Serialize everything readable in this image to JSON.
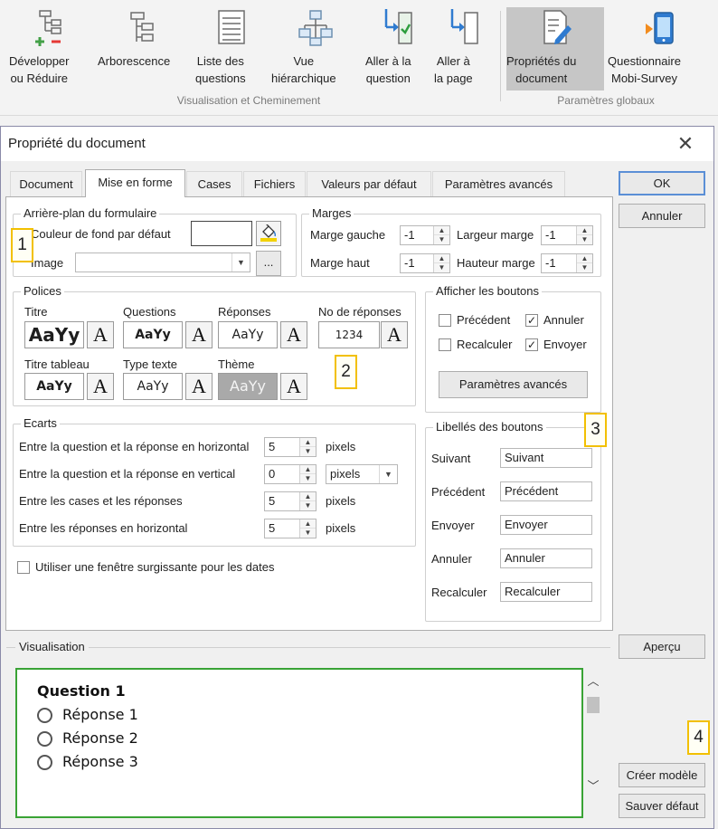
{
  "ribbon": {
    "buttons": [
      {
        "label": "Développer\nou Réduire",
        "icon": "expand-collapse-icon"
      },
      {
        "label": "Arborescence",
        "icon": "tree-icon"
      },
      {
        "label": "Liste des\nquestions",
        "icon": "list-icon"
      },
      {
        "label": "Vue\nhiérarchique",
        "icon": "hierarchy-icon"
      },
      {
        "label": "Aller à la\nquestion",
        "icon": "goto-question-icon"
      },
      {
        "label": "Aller à\nla page",
        "icon": "goto-page-icon"
      },
      {
        "label": "Propriétés du\ndocument",
        "icon": "document-properties-icon"
      },
      {
        "label": "Questionnaire\nMobi-Survey",
        "icon": "mobile-survey-icon"
      }
    ],
    "group1": "Visualisation et Cheminement",
    "group2": "Paramètres globaux"
  },
  "dialog": {
    "title": "Propriété du document",
    "close": "✕",
    "tabs": [
      "Document",
      "Mise en forme",
      "Cases",
      "Fichiers",
      "Valeurs par défaut",
      "Paramètres avancés"
    ],
    "active_tab": "Mise en forme",
    "buttons": {
      "ok": "OK",
      "cancel": "Annuler",
      "preview": "Aperçu",
      "create_template": "Créer modèle",
      "save_default": "Sauver défaut"
    }
  },
  "background": {
    "title": "Arrière-plan du formulaire",
    "bg_color_label": "Couleur de fond par défaut",
    "image_label": "Image",
    "image_value": "",
    "browse": "..."
  },
  "margins": {
    "title": "Marges",
    "left_label": "Marge gauche",
    "left_value": "-1",
    "top_label": "Marge haut",
    "top_value": "-1",
    "width_label": "Largeur marge",
    "width_value": "-1",
    "height_label": "Hauteur marge",
    "height_value": "-1"
  },
  "fonts": {
    "title": "Polices",
    "items": [
      {
        "label": "Titre",
        "sample": "AaYy"
      },
      {
        "label": "Questions",
        "sample": "AaYy"
      },
      {
        "label": "Réponses",
        "sample": "AaYy"
      },
      {
        "label": "No de réponses",
        "sample": "1234"
      },
      {
        "label": "Titre tableau",
        "sample": "AaYy"
      },
      {
        "label": "Type texte",
        "sample": "AaYy"
      },
      {
        "label": "Thème",
        "sample": "AaYy"
      }
    ],
    "font_button_glyph": "A"
  },
  "show_buttons": {
    "title": "Afficher les boutons",
    "previous": {
      "label": "Précédent",
      "checked": false
    },
    "cancel": {
      "label": "Annuler",
      "checked": true
    },
    "recalc": {
      "label": "Recalculer",
      "checked": false
    },
    "send": {
      "label": "Envoyer",
      "checked": true
    },
    "advanced": "Paramètres avancés"
  },
  "spacing": {
    "title": "Ecarts",
    "rows": [
      {
        "label": "Entre la question et la réponse en horizontal",
        "value": "5",
        "unit": "pixels"
      },
      {
        "label": "Entre la question et la réponse en vertical",
        "value": "0",
        "unit": "pixels"
      },
      {
        "label": "Entre les cases et les réponses",
        "value": "5",
        "unit": "pixels"
      },
      {
        "label": "Entre les réponses en horizontal",
        "value": "5",
        "unit": "pixels"
      }
    ]
  },
  "popup_dates": {
    "label": "Utiliser une fenêtre surgissante pour les dates",
    "checked": false
  },
  "button_labels": {
    "title": "Libellés des boutons",
    "rows": [
      {
        "label": "Suivant",
        "value": "Suivant"
      },
      {
        "label": "Précédent",
        "value": "Précédent"
      },
      {
        "label": "Envoyer",
        "value": "Envoyer"
      },
      {
        "label": "Annuler",
        "value": "Annuler"
      },
      {
        "label": "Recalculer",
        "value": "Recalculer"
      }
    ]
  },
  "preview": {
    "title": "Visualisation",
    "question": "Question 1",
    "answers": [
      "Réponse 1",
      "Réponse 2",
      "Réponse 3"
    ]
  },
  "badges": [
    "1",
    "2",
    "3",
    "4"
  ],
  "colors": {
    "accent": "#5b8fd6",
    "preview_border": "#39a335",
    "badge_border": "#f2c000"
  }
}
